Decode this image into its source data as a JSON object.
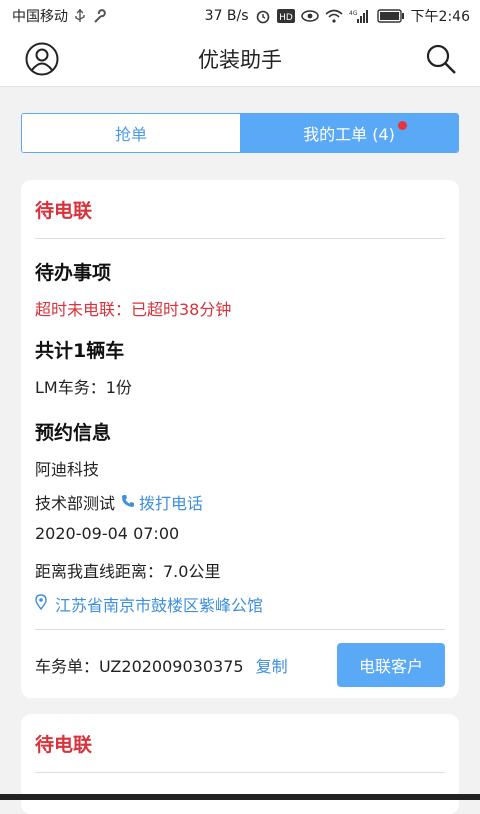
{
  "status_bar": {
    "carrier": "中国移动",
    "speed": "37 B/s",
    "network": "4G",
    "time": "下午2:46"
  },
  "app_bar": {
    "title": "优装助手",
    "left_icon": "user-icon",
    "right_icon": "search-icon"
  },
  "tabs": [
    {
      "label": "抢单",
      "active": false
    },
    {
      "label": "我的工单 (4)",
      "active": true,
      "badge_dot": true
    }
  ],
  "cards": [
    {
      "status": "待电联",
      "todo_title": "待办事项",
      "overdue_text": "超时未电联：已超时38分钟",
      "vehicles_title": "共计1辆车",
      "vehicle_detail": "LM车务：1份",
      "appointment_title": "预约信息",
      "company": "阿迪科技",
      "contact_name": "技术部测试",
      "call_label": "拨打电话",
      "datetime": "2020-09-04 07:00",
      "distance": "距离我直线距离：7.0公里",
      "address": "江苏省南京市鼓楼区紫峰公馆",
      "order_label": "车务单：UZ202009030375",
      "copy_label": "复制",
      "contact_button": "电联客户"
    },
    {
      "status": "待电联"
    }
  ],
  "colors": {
    "accent": "#5aa9f7",
    "link": "#3e8fde",
    "alert": "#d8323b",
    "background": "#f2f2f2"
  }
}
